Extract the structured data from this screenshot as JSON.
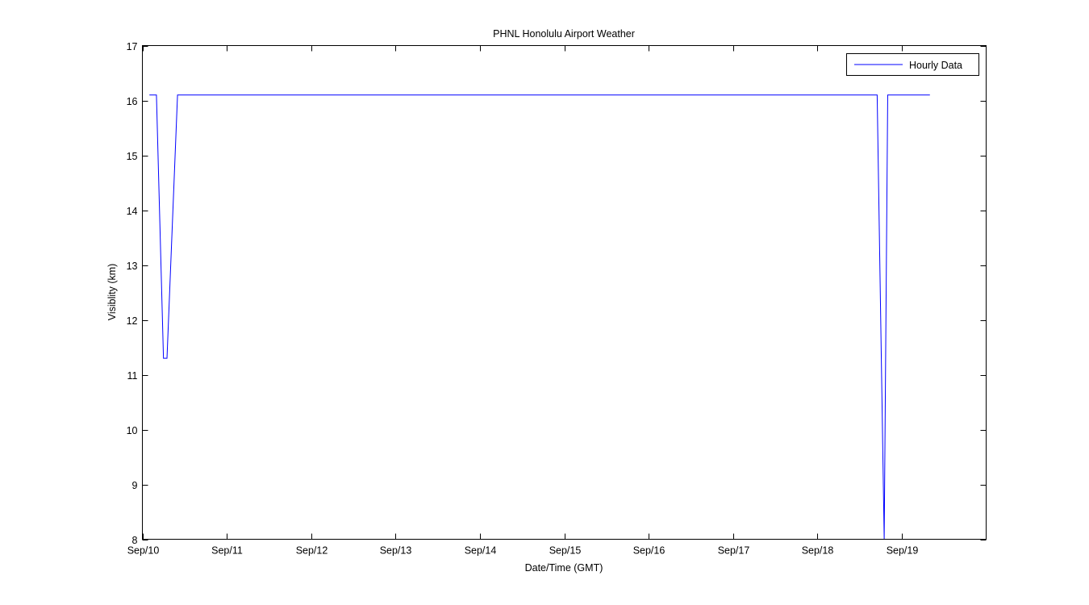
{
  "chart_data": {
    "type": "line",
    "title": "PHNL Honolulu Airport Weather",
    "xlabel": "Date/Time (GMT)",
    "ylabel": "Visiblity (km)",
    "x_ticks": [
      "Sep/10",
      "Sep/11",
      "Sep/12",
      "Sep/13",
      "Sep/14",
      "Sep/15",
      "Sep/16",
      "Sep/17",
      "Sep/18",
      "Sep/19"
    ],
    "x_range": [
      "Sep/10 00:00",
      "Sep/20 00:00"
    ],
    "y_ticks": [
      8,
      9,
      10,
      11,
      12,
      13,
      14,
      15,
      16,
      17
    ],
    "ylim": [
      8,
      17
    ],
    "grid": false,
    "legend_position": "top-right",
    "series": [
      {
        "name": "Hourly Data",
        "color": "#0000ff",
        "points": [
          {
            "x": "Sep/10 02:00",
            "y": 16.1
          },
          {
            "x": "Sep/10 04:00",
            "y": 16.1
          },
          {
            "x": "Sep/10 06:00",
            "y": 11.3
          },
          {
            "x": "Sep/10 07:00",
            "y": 11.3
          },
          {
            "x": "Sep/10 10:00",
            "y": 16.1
          },
          {
            "x": "Sep/18 17:00",
            "y": 16.1
          },
          {
            "x": "Sep/18 19:00",
            "y": 8.0
          },
          {
            "x": "Sep/18 20:00",
            "y": 16.1
          },
          {
            "x": "Sep/19 08:00",
            "y": 16.1
          }
        ]
      }
    ]
  }
}
